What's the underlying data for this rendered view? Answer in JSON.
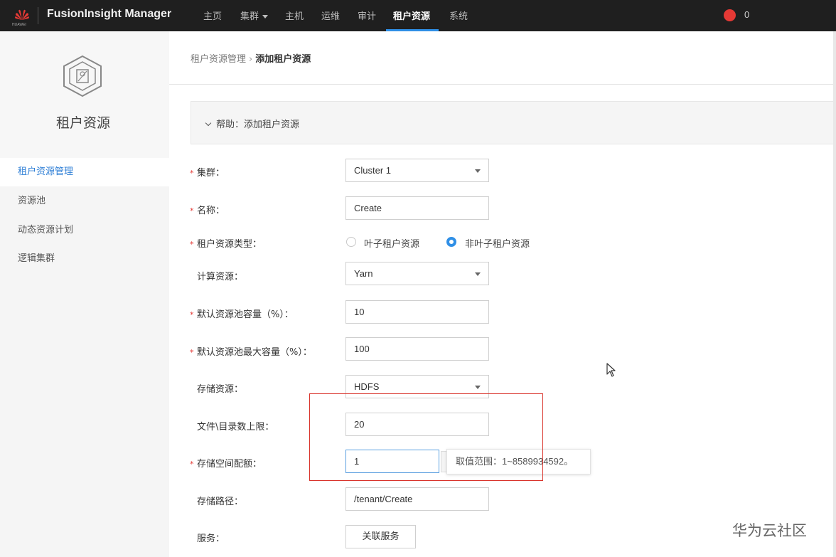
{
  "header": {
    "brand_small": "HUAWEI",
    "title": "FusionInsight Manager",
    "nav": [
      {
        "label": "主页"
      },
      {
        "label": "集群"
      },
      {
        "label": "主机"
      },
      {
        "label": "运维"
      },
      {
        "label": "审计"
      },
      {
        "label": "租户资源"
      },
      {
        "label": "系统"
      }
    ],
    "active_nav": "租户资源",
    "alarm_count": "0",
    "colors": {
      "bar": "#1f1f1f",
      "accent": "#2f8fe6",
      "alarm": "#e53935"
    },
    "icons": [
      "huawei-logo-icon",
      "alarm-icon",
      "caret-down-icon"
    ]
  },
  "sidebar": {
    "title": "租户资源",
    "icon": "tenant-cube-icon",
    "items": [
      {
        "label": "租户资源管理",
        "active": true
      },
      {
        "label": "资源池"
      },
      {
        "label": "动态资源计划"
      },
      {
        "label": "逻辑集群"
      }
    ]
  },
  "breadcrumb": {
    "parent": "租户资源管理",
    "current": "添加租户资源"
  },
  "help": {
    "label": "帮助：添加租户资源"
  },
  "form": {
    "cluster": {
      "label": "集群：",
      "value": "Cluster 1"
    },
    "name": {
      "label": "名称：",
      "value": "Create"
    },
    "tenant_type": {
      "label": "租户资源类型：",
      "options": [
        "叶子租户资源",
        "非叶子租户资源"
      ],
      "selected": "非叶子租户资源"
    },
    "compute": {
      "label": "计算资源：",
      "value": "Yarn"
    },
    "default_capacity": {
      "label": "默认资源池容量（%）：",
      "value": "10"
    },
    "default_max_capacity": {
      "label": "默认资源池最大容量（%）：",
      "value": "100"
    },
    "storage": {
      "label": "存储资源：",
      "value": "HDFS"
    },
    "file_limit": {
      "label": "文件\\目录数上限：",
      "value": "20"
    },
    "storage_quota": {
      "label": "存储空间配额：",
      "value": "1",
      "tooltip": "取值范围：1~8589934592。"
    },
    "storage_path": {
      "label": "存储路径：",
      "value": "/tenant/Create"
    },
    "service": {
      "label": "服务：",
      "button": "关联服务"
    }
  },
  "watermark": "华为云社区",
  "highlight_color": "#d9332b"
}
